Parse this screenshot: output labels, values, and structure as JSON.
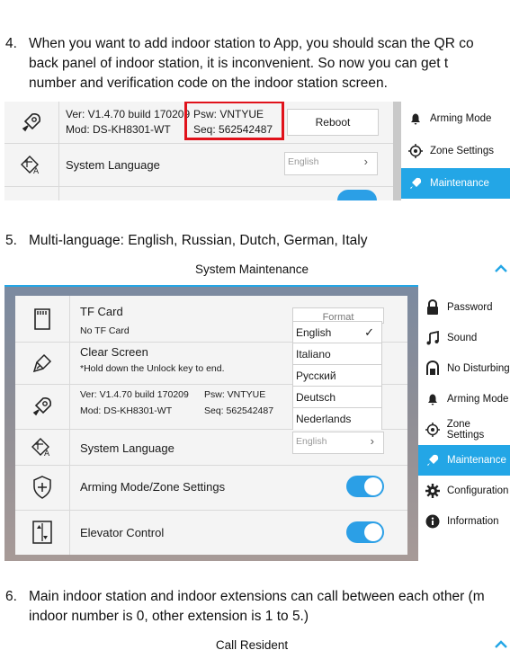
{
  "step4": {
    "number": "4.",
    "line1": "When you want to add indoor station to App, you should scan the QR co",
    "line2": "back panel of indoor station, it is inconvenient. So now you can get t",
    "line3": "number and verification code on the indoor station screen."
  },
  "shot1": {
    "ver": "Ver: V1.4.70 build 170209",
    "mod": "Mod: DS-KH8301-WT",
    "psw": "Psw: VNTYUE",
    "seq": "Seq: 562542487",
    "reboot": "Reboot",
    "system_language": "System Language",
    "language_value": "English",
    "sidebar": [
      "Arming Mode",
      "Zone Settings",
      "Maintenance"
    ],
    "highlight_color": "#e0121b"
  },
  "step5": {
    "number": "5.",
    "text": "Multi-language: English, Russian, Dutch, German, Italy"
  },
  "shot2": {
    "title": "System Maintenance",
    "tf_card": "TF Card",
    "no_tf_card": "No TF Card",
    "format": "Format",
    "clear_screen": "Clear Screen",
    "clear_hint": "*Hold down the Unlock key to end.",
    "ver": "Ver: V1.4.70 build 170209",
    "mod": "Mod: DS-KH8301-WT",
    "psw": "Psw: VNTYUE",
    "seq": "Seq: 562542487",
    "system_language": "System Language",
    "language_value": "English",
    "arming_zone": "Arming Mode/Zone Settings",
    "elevator": "Elevator Control",
    "dropdown": [
      "English",
      "Italiano",
      "Русский",
      "Deutsch",
      "Nederlands"
    ],
    "checkmark": "✓",
    "sidebar": [
      "Password",
      "Sound",
      "No Disturbing",
      "Arming Mode",
      "Zone Settings",
      "Maintenance",
      "Configuration",
      "Information"
    ],
    "accent_color": "#23a6e6"
  },
  "step6": {
    "number": "6.",
    "line1": "Main indoor station and indoor extensions can call between each other (m",
    "line2": "indoor number is 0, other extension is 1 to 5.)"
  },
  "shot3": {
    "title": "Call Resident"
  }
}
